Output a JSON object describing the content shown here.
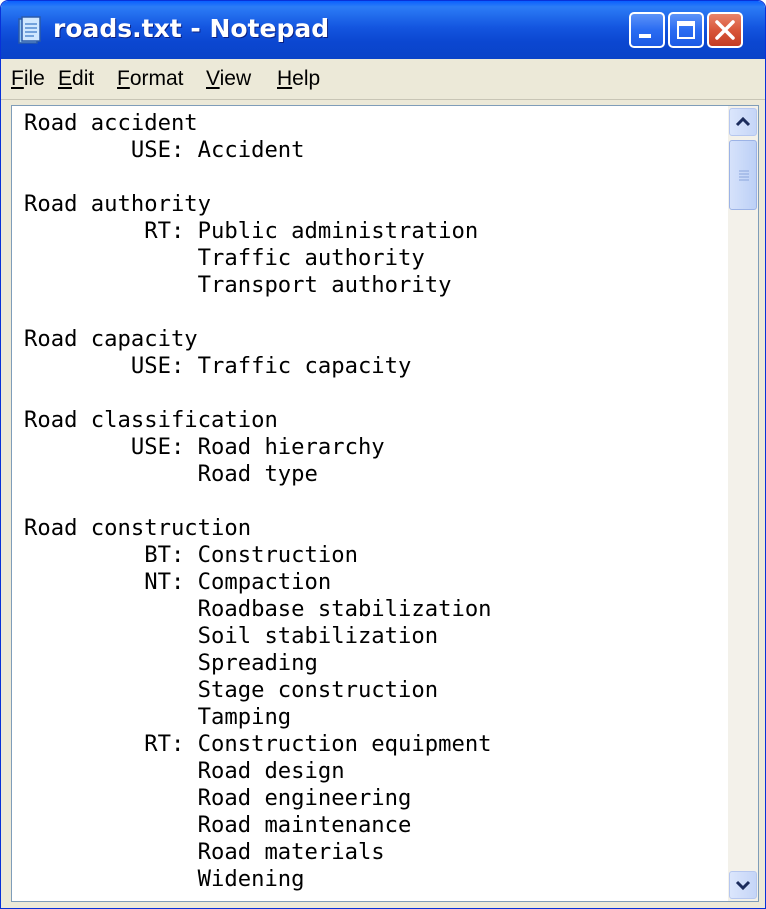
{
  "window": {
    "title": "roads.txt - Notepad",
    "icon": "notepad-icon"
  },
  "menu": {
    "file": "File",
    "edit": "Edit",
    "format": "Format",
    "view": "View",
    "help": "Help"
  },
  "document": {
    "text": "Road accident\n        USE: Accident\n\nRoad authority\n         RT: Public administration\n             Traffic authority\n             Transport authority\n\nRoad capacity\n        USE: Traffic capacity\n\nRoad classification\n        USE: Road hierarchy\n             Road type\n\nRoad construction\n         BT: Construction\n         NT: Compaction\n             Roadbase stabilization\n             Soil stabilization\n             Spreading\n             Stage construction\n             Tamping\n         RT: Construction equipment\n             Road design\n             Road engineering\n             Road maintenance\n             Road materials\n             Widening"
  },
  "colors": {
    "titlebar": "#0b47d1",
    "close_button": "#d9573a",
    "chrome": "#ece9d8"
  }
}
